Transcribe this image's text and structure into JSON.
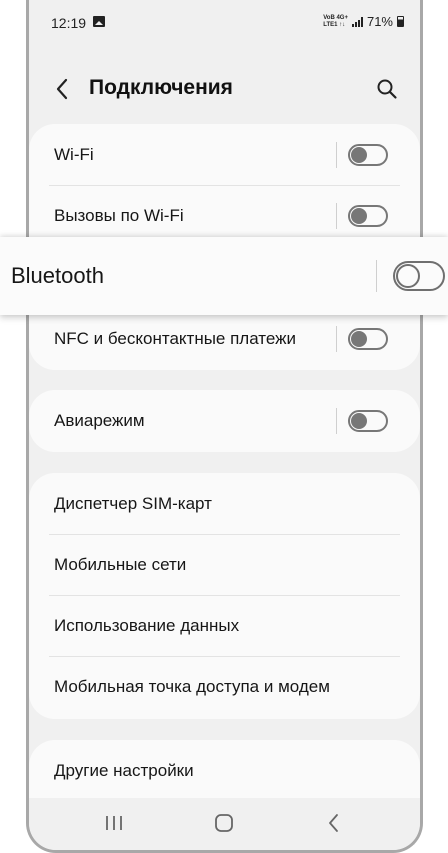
{
  "status_bar": {
    "time": "12:19",
    "net_top": "VoB 4G+",
    "net_bottom": "LTE1 ↑↓",
    "battery": "71%"
  },
  "header": {
    "title": "Подключения",
    "back_icon": "chevron-left-icon",
    "search_icon": "search-icon"
  },
  "group1": {
    "wifi": {
      "label": "Wi-Fi",
      "enabled": false
    },
    "wifi_calling": {
      "label": "Вызовы по Wi-Fi",
      "enabled": false
    },
    "bluetooth": {
      "label": "Bluetooth",
      "enabled": false
    },
    "nfc": {
      "label": "NFC и бесконтактные платежи",
      "enabled": false
    }
  },
  "group2": {
    "airplane": {
      "label": "Авиарежим",
      "enabled": false
    }
  },
  "group3": {
    "items": [
      {
        "label": "Диспетчер SIM-карт"
      },
      {
        "label": "Мобильные сети"
      },
      {
        "label": "Использование данных"
      },
      {
        "label": "Мобильная точка доступа и модем"
      }
    ]
  },
  "group4": {
    "items": [
      {
        "label": "Другие настройки"
      }
    ]
  },
  "nav_bar": {
    "recents_icon": "recents-icon",
    "home_icon": "home-icon",
    "back_icon": "back-icon"
  }
}
